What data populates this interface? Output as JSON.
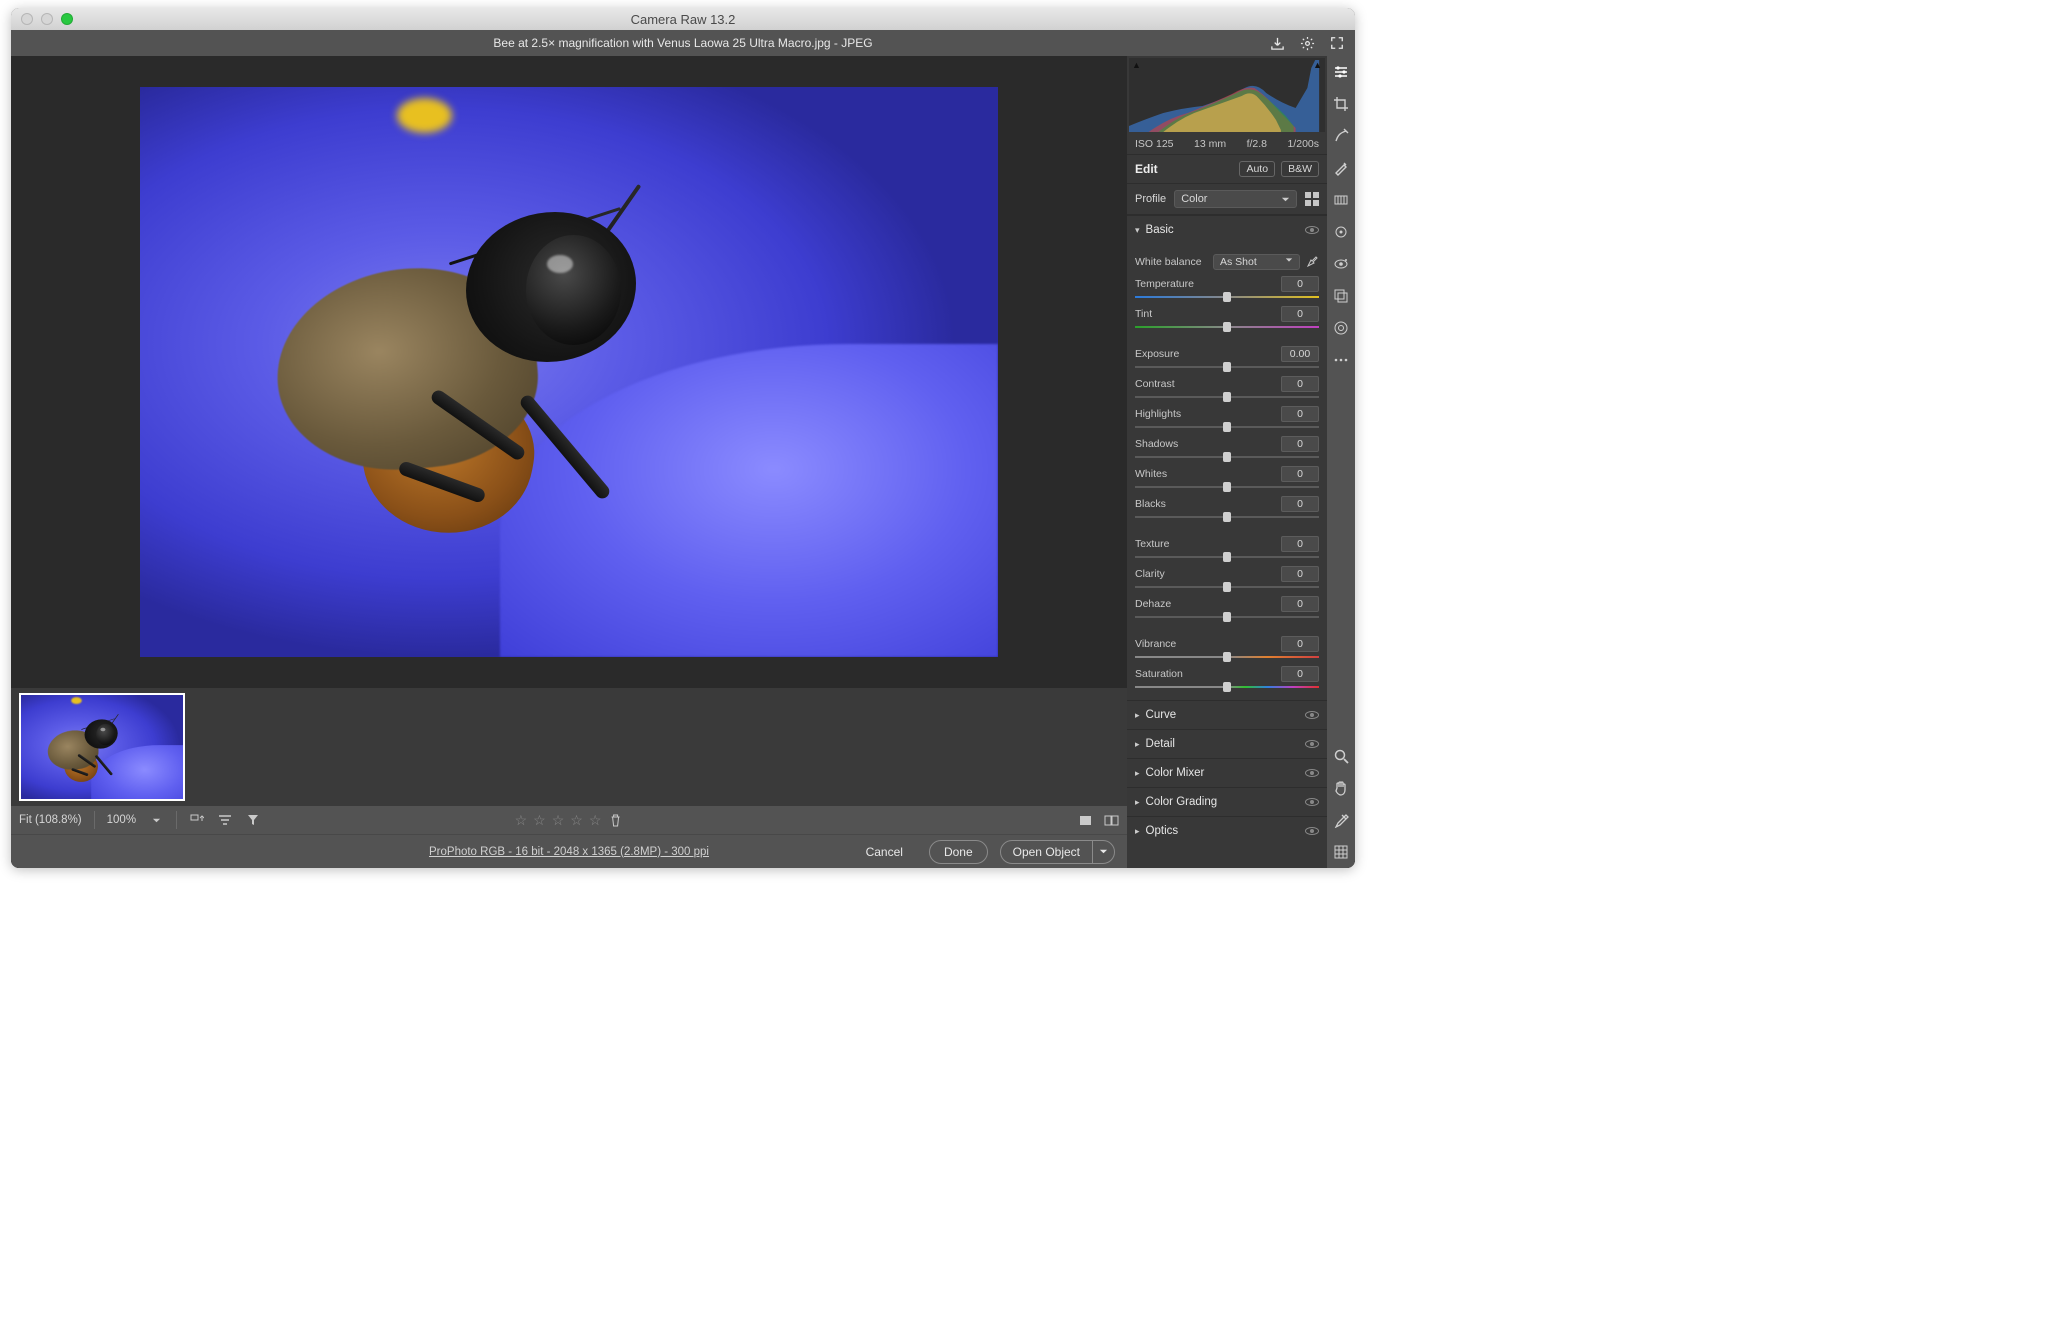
{
  "window_title": "Camera Raw 13.2",
  "header_filename": "Bee at 2.5× magnification with Venus Laowa 25 Ultra Macro.jpg  -  JPEG",
  "meta": {
    "iso": "ISO 125",
    "focal": "13 mm",
    "aperture": "f/2.8",
    "shutter": "1/200s"
  },
  "edit_label": "Edit",
  "auto_label": "Auto",
  "bw_label": "B&W",
  "profile_label": "Profile",
  "profile_value": "Color",
  "sections": {
    "basic": "Basic",
    "curve": "Curve",
    "detail": "Detail",
    "color_mixer": "Color Mixer",
    "color_grading": "Color Grading",
    "optics": "Optics"
  },
  "wb_label": "White balance",
  "wb_value": "As Shot",
  "sliders": {
    "temperature": {
      "label": "Temperature",
      "value": "0"
    },
    "tint": {
      "label": "Tint",
      "value": "0"
    },
    "exposure": {
      "label": "Exposure",
      "value": "0.00"
    },
    "contrast": {
      "label": "Contrast",
      "value": "0"
    },
    "highlights": {
      "label": "Highlights",
      "value": "0"
    },
    "shadows": {
      "label": "Shadows",
      "value": "0"
    },
    "whites": {
      "label": "Whites",
      "value": "0"
    },
    "blacks": {
      "label": "Blacks",
      "value": "0"
    },
    "texture": {
      "label": "Texture",
      "value": "0"
    },
    "clarity": {
      "label": "Clarity",
      "value": "0"
    },
    "dehaze": {
      "label": "Dehaze",
      "value": "0"
    },
    "vibrance": {
      "label": "Vibrance",
      "value": "0"
    },
    "saturation": {
      "label": "Saturation",
      "value": "0"
    }
  },
  "status": {
    "fit": "Fit (108.8%)",
    "zoom": "100%"
  },
  "footer_info": "ProPhoto RGB - 16 bit - 2048 x 1365 (2.8MP) - 300 ppi",
  "buttons": {
    "cancel": "Cancel",
    "done": "Done",
    "open_object": "Open Object"
  }
}
